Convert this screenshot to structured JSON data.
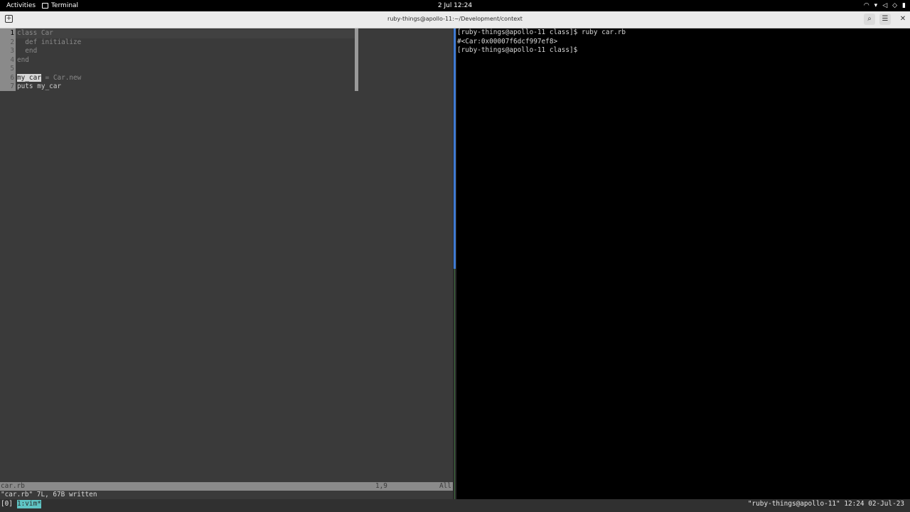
{
  "topbar": {
    "activities": "Activities",
    "app_name": "Terminal",
    "clock": "2 Jul 12:24",
    "tray_icons": [
      "wifi-icon",
      "power-indicator-icon",
      "volume-icon",
      "network-icon",
      "battery-icon"
    ]
  },
  "window": {
    "title": "ruby-things@apollo-11:~/Development/context",
    "new_tab_icon": "+",
    "search_icon": "⌕",
    "menu_icon": "☰",
    "close_icon": "✕"
  },
  "vim": {
    "line_numbers": [
      "1",
      "2",
      "3",
      "4",
      "5",
      "6",
      "7"
    ],
    "code": {
      "l1_kw": "class",
      "l1_name": "Car",
      "l2": "  def initialize",
      "l3": "  end",
      "l4": "end",
      "l5": "",
      "l6_hl": "my_car",
      "l6_eq": " = ",
      "l6_class": "Car",
      "l6_rest": ".new",
      "l7": "puts my_car"
    },
    "status_filename": "car.rb",
    "status_position": "1,9",
    "status_scroll": "All",
    "command_line": "\"car.rb\" 7L, 67B written"
  },
  "shell": {
    "lines": [
      "[ruby-things@apollo-11 class]$ ruby car.rb",
      "#<Car:0x00007f6dcf997ef8>",
      "[ruby-things@apollo-11 class]$"
    ]
  },
  "tmux": {
    "session": "[0]",
    "window_name": "1:vim*",
    "right": "\"ruby-things@apollo-11\" 12:24 02-Jul-23"
  },
  "colors": {
    "vim_background": "#3a3a3a",
    "shell_background": "#000000",
    "active_pane_border": "#3e7ad3",
    "tmux_window_highlight": "#5fc4c4"
  }
}
